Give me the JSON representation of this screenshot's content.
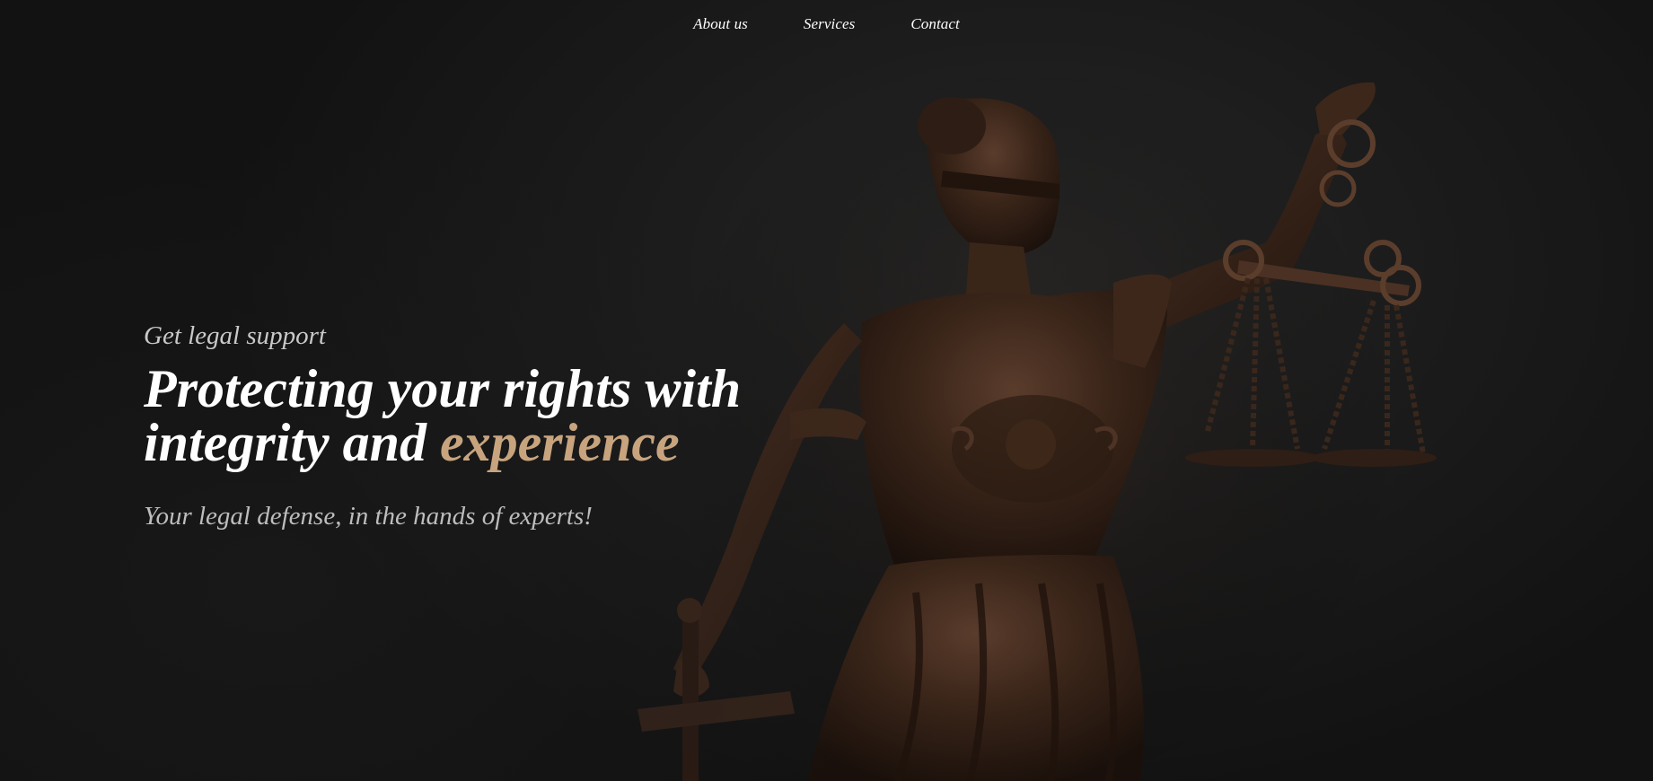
{
  "nav": {
    "items": [
      {
        "label": "About us"
      },
      {
        "label": "Services"
      },
      {
        "label": "Contact"
      }
    ]
  },
  "hero": {
    "eyebrow": "Get legal support",
    "headline_line1": "Protecting your rights with",
    "headline_line2_prefix": "integrity and ",
    "headline_accent": "experience",
    "tagline": "Your legal defense, in the hands of experts!"
  },
  "colors": {
    "background": "#141414",
    "accent": "#c8a47e",
    "text_primary": "#ffffff",
    "text_secondary": "#bdbdbd"
  },
  "image": {
    "icon": "lady-justice-statue"
  }
}
